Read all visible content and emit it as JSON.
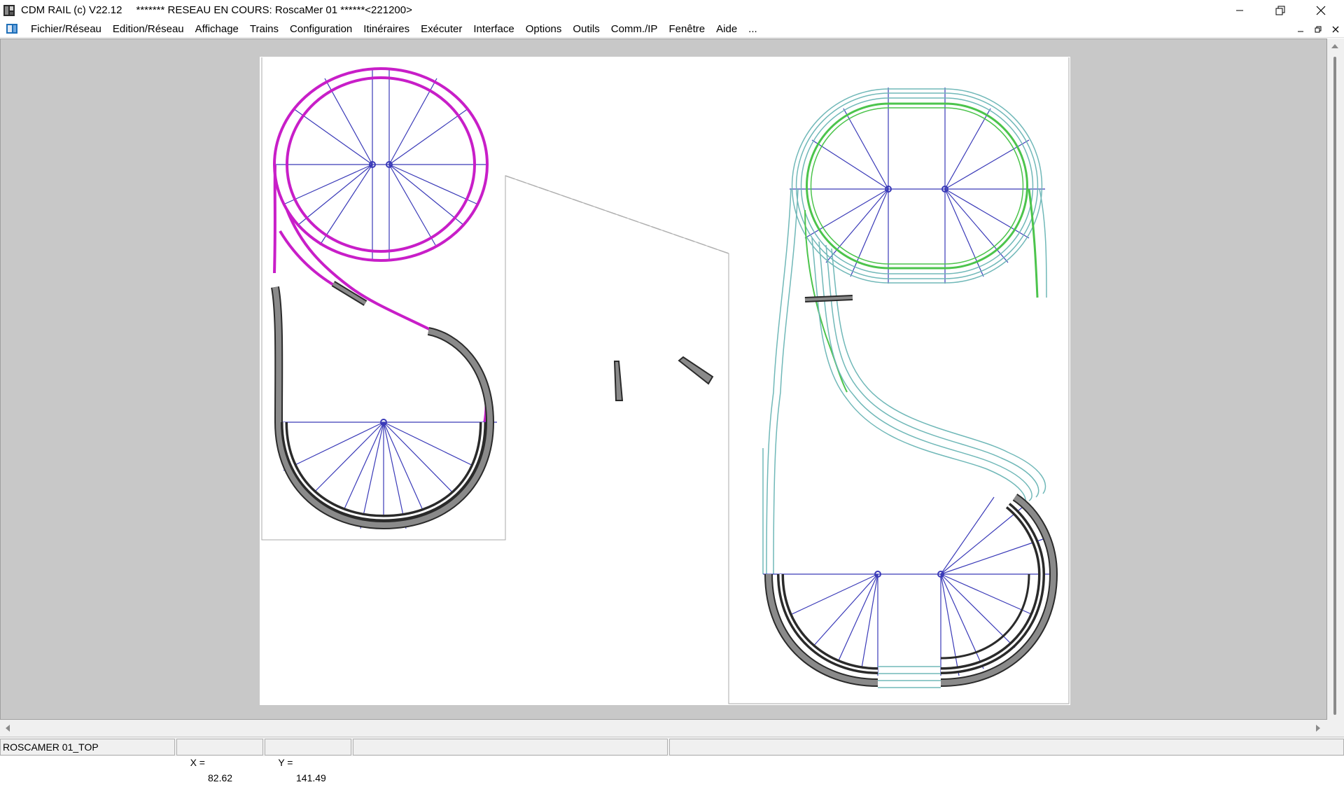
{
  "window": {
    "title": "CDM RAIL (c) V22.12",
    "status": "******* RESEAU EN COURS: RoscaMer 01 ******<221200>"
  },
  "menu": [
    "Fichier/Réseau",
    "Edition/Réseau",
    "Affichage",
    "Trains",
    "Configuration",
    "Itinéraires",
    "Exécuter",
    "Interface",
    "Options",
    "Outils",
    "Comm./IP",
    "Fenêtre",
    "Aide",
    "..."
  ],
  "statusbar": {
    "layer_name": "ROSCAMER 01_TOP",
    "x_label": "X =",
    "x_value": "82.62",
    "y_label": "Y =",
    "y_value": "141.49"
  },
  "colors": {
    "selected_track": "#c81ec8",
    "occupied_track": "#8a8a8a",
    "track_outline": "#70b8b8",
    "active_loop": "#4cc44c",
    "radius_lines": "#3a3ab8",
    "workspace": "#c8c8c8"
  },
  "icons": [
    "app-icon",
    "document-icon",
    "minimize-icon",
    "maximize-icon",
    "close-icon"
  ]
}
